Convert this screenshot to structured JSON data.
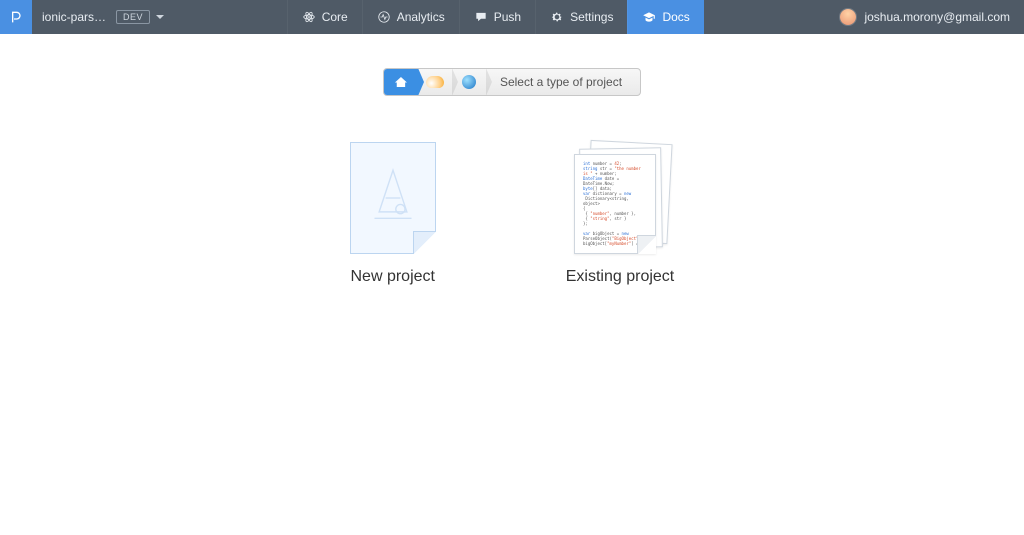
{
  "header": {
    "app_name": "ionic-pars…",
    "env_label": "DEV",
    "nav": [
      {
        "label": "Core"
      },
      {
        "label": "Analytics"
      },
      {
        "label": "Push"
      },
      {
        "label": "Settings"
      },
      {
        "label": "Docs"
      }
    ],
    "user_email": "joshua.morony@gmail.com"
  },
  "breadcrumb": {
    "label": "Select a type of project"
  },
  "cards": {
    "new_label": "New project",
    "existing_label": "Existing project"
  }
}
